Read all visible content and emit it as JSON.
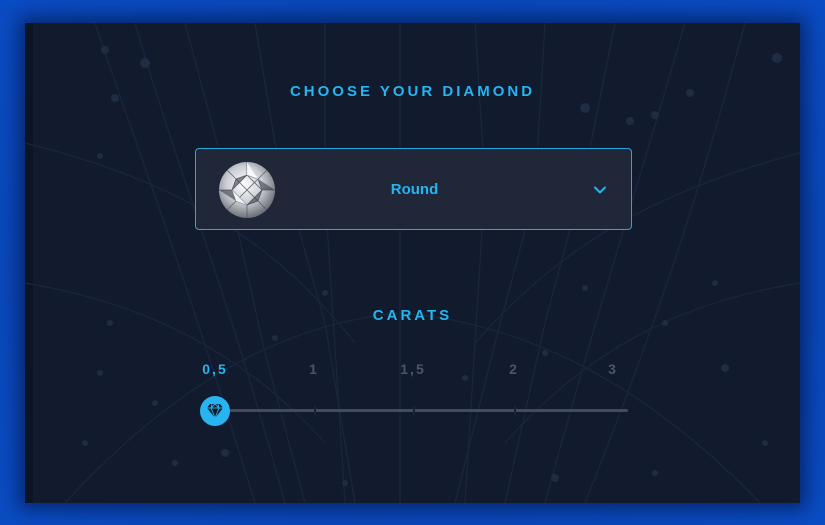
{
  "header": {
    "title": "CHOOSE YOUR DIAMOND"
  },
  "shape_selector": {
    "selected": "Round"
  },
  "carats": {
    "title": "CARATS",
    "ticks": [
      "0,5",
      "1",
      "1,5",
      "2",
      "3"
    ],
    "selected": "0,5",
    "slider_fraction": 0
  },
  "colors": {
    "accent": "#27b4f0",
    "card_bg": "#111b2d",
    "page_bg": "#0a47b8",
    "inactive_tick": "#4a5567"
  },
  "icons": {
    "dropdown": "chevron-down-icon",
    "handle": "diamond-icon",
    "preview": "round-diamond-image"
  }
}
